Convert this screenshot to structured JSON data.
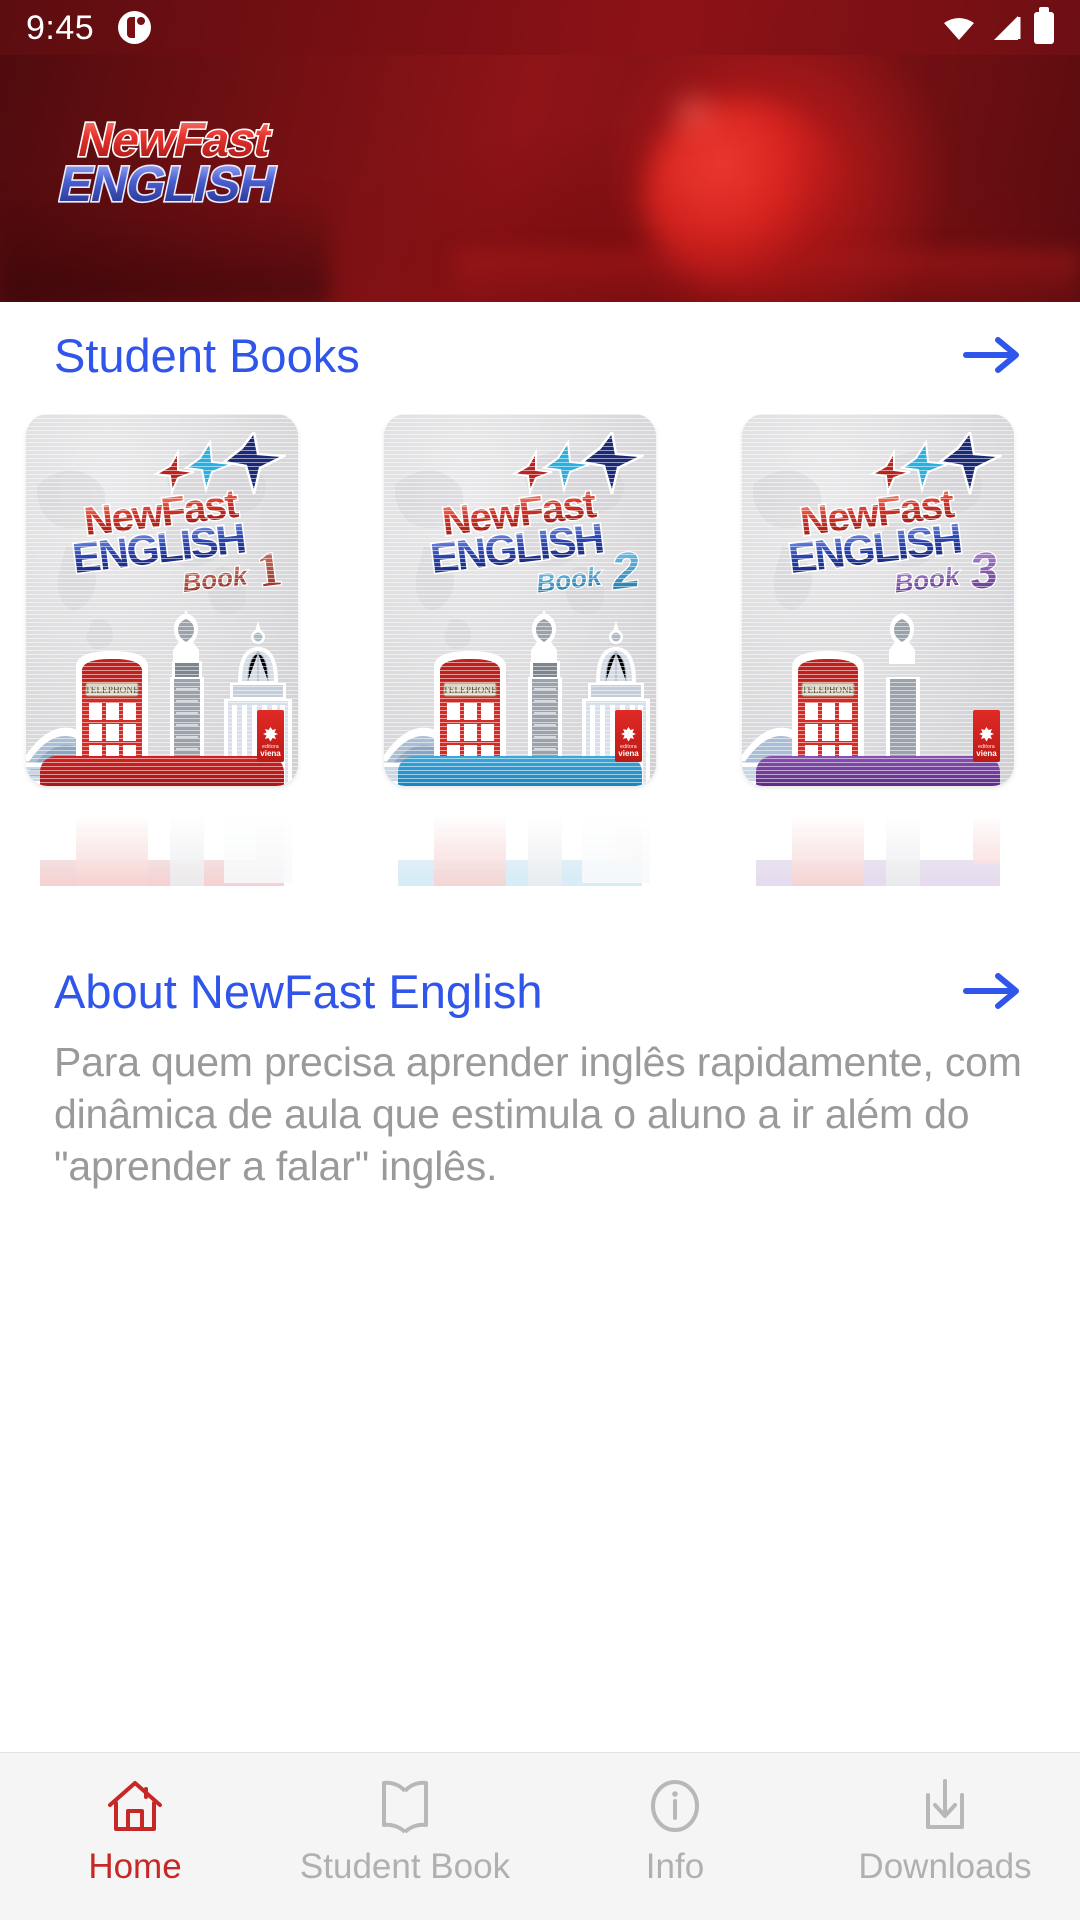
{
  "statusbar": {
    "time": "9:45",
    "app_badge_icon": "app-notification-icon",
    "wifi_icon": "wifi-icon",
    "signal_icon": "cellular-signal-icon",
    "battery_icon": "battery-full-icon"
  },
  "header": {
    "logo_line1": "NewFast",
    "logo_line2": "ENGLISH",
    "background_description": "red-apple-photo",
    "accent_red": "#8e1418"
  },
  "sections": {
    "student_books": {
      "title": "Student Books",
      "arrow_icon": "arrow-right-icon",
      "books": [
        {
          "brand_line1": "NewFast",
          "brand_line2": "ENGLISH",
          "book_label": "Book",
          "book_number": "1",
          "number_color": "#b5342a",
          "bar_color": "#c4161c",
          "publisher_line1": "editora",
          "publisher_line2": "viena",
          "telephone_label": "TELEPHONE"
        },
        {
          "brand_line1": "NewFast",
          "brand_line2": "ENGLISH",
          "book_label": "Book",
          "book_number": "2",
          "number_color": "#2590c9",
          "bar_color": "#2b9ad4",
          "publisher_line1": "editora",
          "publisher_line2": "viena",
          "telephone_label": "TELEPHONE"
        },
        {
          "brand_line1": "NewFast",
          "brand_line2": "ENGLISH",
          "book_label": "Book",
          "book_number": "3",
          "number_color": "#6d3f9c",
          "bar_color": "#7a3fa0",
          "publisher_line1": "editora",
          "publisher_line2": "viena",
          "telephone_label": "TELEPHONE"
        }
      ]
    },
    "about": {
      "title": "About NewFast English",
      "arrow_icon": "arrow-right-icon",
      "description": "Para quem precisa aprender inglês rapidamente, com dinâmica de aula que estimula o aluno a ir além do \"aprender a falar\" inglês."
    }
  },
  "bottom_nav": {
    "active_color": "#c62828",
    "inactive_color": "#b0b0b0",
    "items": [
      {
        "label": "Home",
        "icon": "home-icon",
        "active": true
      },
      {
        "label": "Student Book",
        "icon": "book-open-icon",
        "active": false
      },
      {
        "label": "Info",
        "icon": "info-circle-icon",
        "active": false
      },
      {
        "label": "Downloads",
        "icon": "download-icon",
        "active": false
      }
    ]
  }
}
